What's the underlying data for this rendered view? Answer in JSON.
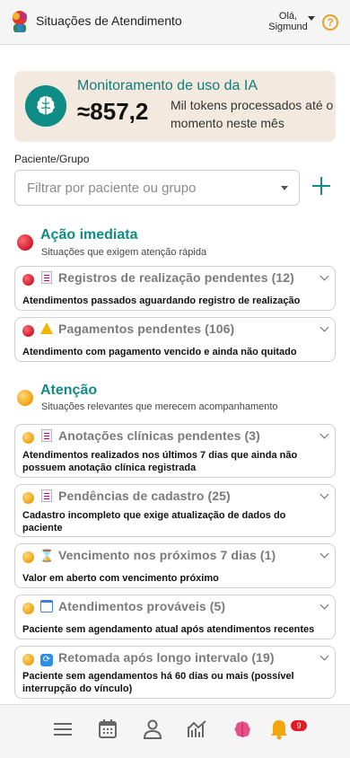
{
  "header": {
    "title": "Situações de Atendimento",
    "greeting": "Olá,",
    "user_name": "Sigmund",
    "help_icon": "?"
  },
  "ai_usage": {
    "title": "Monitoramento de uso da IA",
    "value": "≈857,2",
    "description": "Mil tokens processados até o momento neste mês"
  },
  "filter": {
    "label": "Paciente/Grupo",
    "placeholder": "Filtrar por paciente ou grupo"
  },
  "sections": [
    {
      "title": "Ação imediata",
      "subtitle": "Situações que exigem atenção rápida",
      "items": [
        {
          "title": "Registros de realização pendentes (12)",
          "description": "Atendimentos passados aguardando registro de realização"
        },
        {
          "title": "Pagamentos pendentes (106)",
          "description": "Atendimento com pagamento vencido e ainda não quitado"
        }
      ]
    },
    {
      "title": "Atenção",
      "subtitle": "Situações relevantes que merecem acompanhamento",
      "items": [
        {
          "title": "Anotações clínicas pendentes (3)",
          "description": "Atendimentos realizados nos últimos 7 dias que ainda não possuem anotação clínica registrada"
        },
        {
          "title": "Pendências de cadastro (25)",
          "description": "Cadastro incompleto que exige atualização de dados do paciente"
        },
        {
          "title": "Vencimento nos próximos 7 dias (1)",
          "description": "Valor em aberto com vencimento próximo"
        },
        {
          "title": "Atendimentos prováveis (5)",
          "description": "Paciente sem agendamento atual após atendimentos recentes"
        },
        {
          "title": "Retomada após longo intervalo (19)",
          "description": "Paciente sem agendamentos há 60 dias ou mais (possível interrupção do vínculo)"
        }
      ]
    }
  ],
  "bottom_nav": {
    "notification_count": "9"
  },
  "colors": {
    "accent": "#0f8c86",
    "urgent": "#d11a2a",
    "attention": "#f0a010"
  }
}
